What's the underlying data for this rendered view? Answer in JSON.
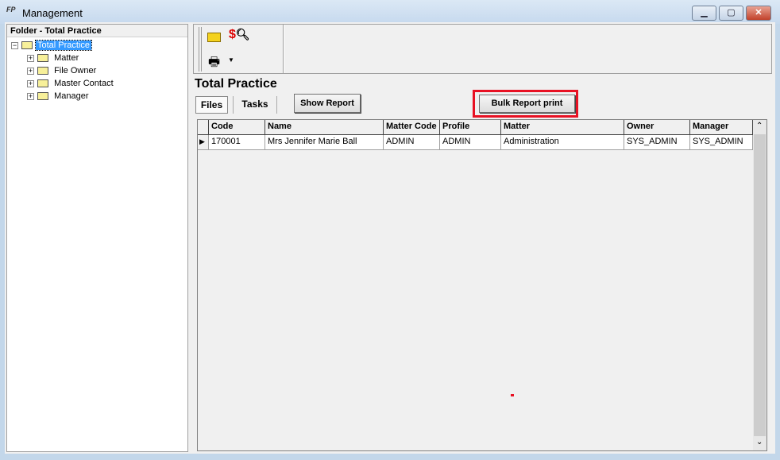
{
  "window": {
    "title": "Management",
    "icon": "fp-app-icon",
    "minimize": "minimize-icon",
    "maximize": "maximize-icon",
    "close": "close-icon"
  },
  "left_panel": {
    "header": "Folder - Total Practice",
    "root": "Total Practice",
    "children": [
      "Matter",
      "File Owner",
      "Master Contact",
      "Manager"
    ]
  },
  "toolbar": {
    "icons": [
      "open-folder-icon",
      "search-money-icon",
      "printer-icon",
      "dropdown-arrow-icon"
    ]
  },
  "main": {
    "title": "Total Practice",
    "tabs": [
      {
        "label": "Files",
        "active": true
      },
      {
        "label": "Tasks",
        "active": false
      }
    ],
    "show_report_label": "Show Report",
    "bulk_report_label": "Bulk Report print",
    "highlight_color": "#e81123",
    "grid": {
      "columns": [
        "Code",
        "Name",
        "Matter Code",
        "Profile",
        "Matter",
        "Owner",
        "Manager"
      ],
      "rows": [
        [
          "170001",
          "Mrs Jennifer Marie Ball",
          "ADMIN",
          "ADMIN",
          "Administration",
          "SYS_ADMIN",
          "SYS_ADMIN"
        ]
      ]
    }
  }
}
